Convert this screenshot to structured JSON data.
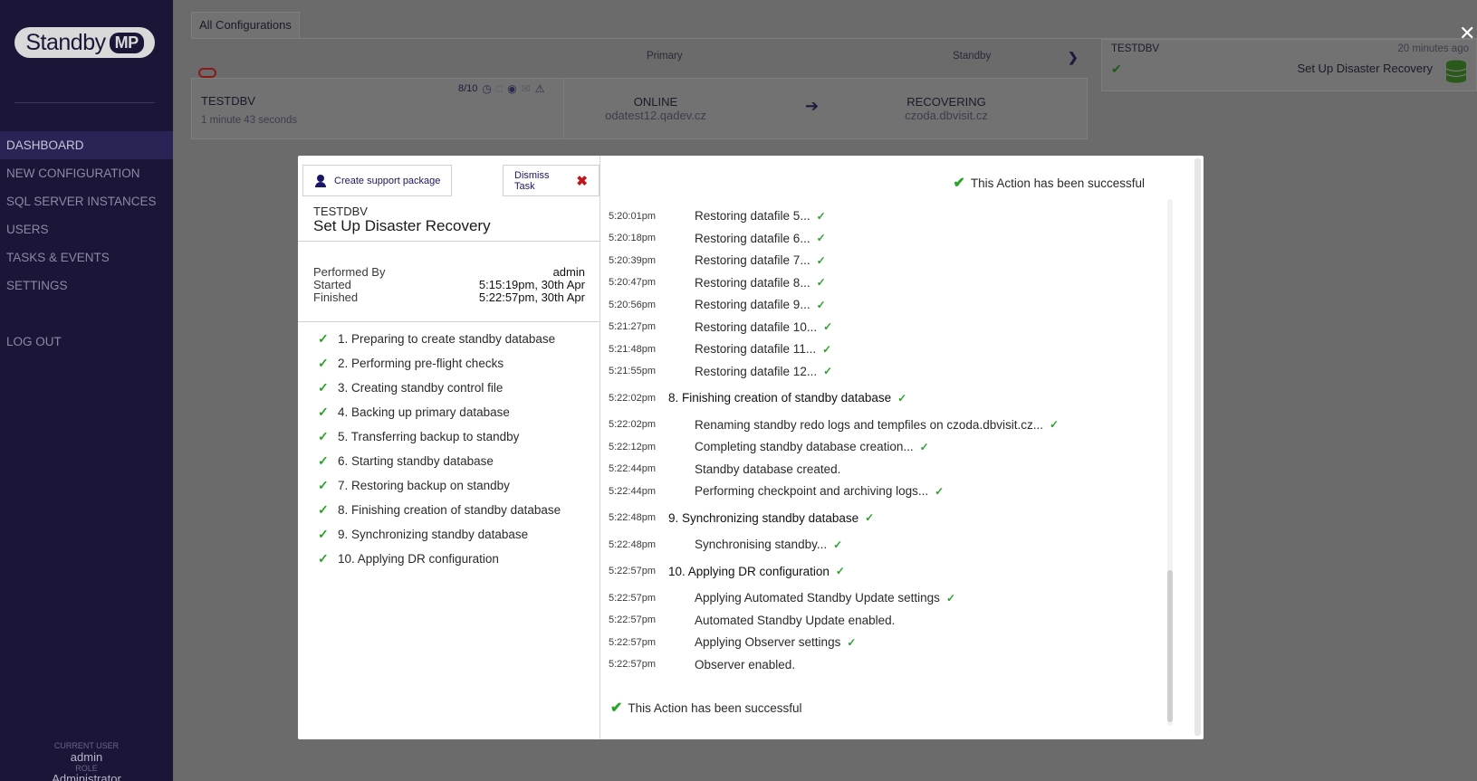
{
  "app": {
    "logo_text": "Standby",
    "logo_badge": "MP"
  },
  "sidebar": {
    "items": [
      {
        "label": "DASHBOARD"
      },
      {
        "label": "NEW CONFIGURATION"
      },
      {
        "label": "SQL SERVER INSTANCES"
      },
      {
        "label": "USERS"
      },
      {
        "label": "TASKS & EVENTS"
      },
      {
        "label": "SETTINGS"
      }
    ],
    "logout": "LOG OUT",
    "current_user_label": "CURRENT USER",
    "current_user": "admin",
    "role_label": "ROLE",
    "role": "Administrator"
  },
  "main": {
    "tab_all": "All Configurations",
    "col_primary": "Primary",
    "col_standby": "Standby",
    "config": {
      "name": "TESTDBV",
      "elapsed": "1 minute 43 seconds",
      "score": "8/10",
      "primary_status": "ONLINE",
      "primary_host": "odatest12.qadev.cz",
      "standby_status": "RECOVERING",
      "standby_host": "czoda.dbvisit.cz"
    },
    "task_card": {
      "db": "TESTDBV",
      "when": "20 minutes ago",
      "title": "Set Up Disaster Recovery"
    }
  },
  "modal": {
    "support_button": "Create support package",
    "dismiss_button": "Dismiss Task",
    "db": "TESTDBV",
    "title": "Set Up Disaster Recovery",
    "performed_by_label": "Performed By",
    "performed_by": "admin",
    "started_label": "Started",
    "started": "5:15:19pm, 30th Apr",
    "finished_label": "Finished",
    "finished": "5:22:57pm, 30th Apr",
    "steps": [
      "1. Preparing to create standby database",
      "2. Performing pre-flight checks",
      "3. Creating standby control file",
      "4. Backing up primary database",
      "5. Transferring backup to standby",
      "6. Starting standby database",
      "7. Restoring backup on standby",
      "8. Finishing creation of standby database",
      "9. Synchronizing standby database",
      "10. Applying DR configuration"
    ],
    "success_text": "This Action has been successful",
    "log": [
      {
        "time": "5:20:01pm",
        "msg": "Restoring datafile 5...",
        "ok": true,
        "kind": "sub"
      },
      {
        "time": "5:20:18pm",
        "msg": "Restoring datafile 6...",
        "ok": true,
        "kind": "sub"
      },
      {
        "time": "5:20:39pm",
        "msg": "Restoring datafile 7...",
        "ok": true,
        "kind": "sub"
      },
      {
        "time": "5:20:47pm",
        "msg": "Restoring datafile 8...",
        "ok": true,
        "kind": "sub"
      },
      {
        "time": "5:20:56pm",
        "msg": "Restoring datafile 9...",
        "ok": true,
        "kind": "sub"
      },
      {
        "time": "5:21:27pm",
        "msg": "Restoring datafile 10...",
        "ok": true,
        "kind": "sub"
      },
      {
        "time": "5:21:48pm",
        "msg": "Restoring datafile 11...",
        "ok": true,
        "kind": "sub"
      },
      {
        "time": "5:21:55pm",
        "msg": "Restoring datafile 12...",
        "ok": true,
        "kind": "sub"
      },
      {
        "time": "5:22:02pm",
        "msg": "8. Finishing creation of standby database",
        "ok": true,
        "kind": "head"
      },
      {
        "time": "5:22:02pm",
        "msg": "Renaming standby redo logs and tempfiles on czoda.dbvisit.cz...",
        "ok": true,
        "kind": "sub"
      },
      {
        "time": "5:22:12pm",
        "msg": "Completing standby database creation...",
        "ok": true,
        "kind": "sub"
      },
      {
        "time": "5:22:44pm",
        "msg": "Standby database created.",
        "ok": false,
        "kind": "sub"
      },
      {
        "time": "5:22:44pm",
        "msg": "Performing checkpoint and archiving logs...",
        "ok": true,
        "kind": "sub"
      },
      {
        "time": "5:22:48pm",
        "msg": "9. Synchronizing standby database",
        "ok": true,
        "kind": "head"
      },
      {
        "time": "5:22:48pm",
        "msg": "Synchronising standby...",
        "ok": true,
        "kind": "sub"
      },
      {
        "time": "5:22:57pm",
        "msg": "10. Applying DR configuration",
        "ok": true,
        "kind": "head"
      },
      {
        "time": "5:22:57pm",
        "msg": "Applying Automated Standby Update settings",
        "ok": true,
        "kind": "sub"
      },
      {
        "time": "5:22:57pm",
        "msg": "Automated Standby Update enabled.",
        "ok": false,
        "kind": "sub"
      },
      {
        "time": "5:22:57pm",
        "msg": "Applying Observer settings",
        "ok": true,
        "kind": "sub"
      },
      {
        "time": "5:22:57pm",
        "msg": "Observer enabled.",
        "ok": false,
        "kind": "sub"
      }
    ]
  },
  "colors": {
    "sidebar_bg": "#1b1538",
    "accent": "#1b1568",
    "success": "#2aa32a",
    "danger": "#c0151a"
  }
}
